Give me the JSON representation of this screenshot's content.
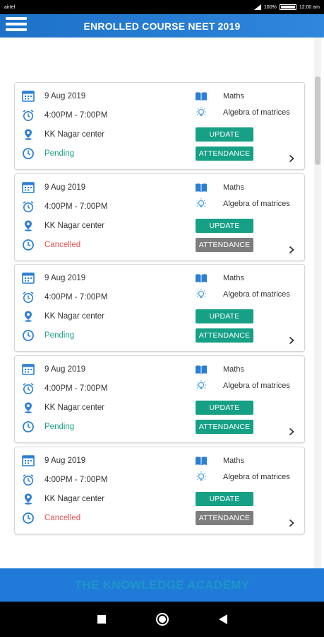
{
  "status_bar": {
    "carrier": "airtel",
    "battery": "100%",
    "time": "12:00 am"
  },
  "app_bar": {
    "title": "ENROLLED COURSE NEET 2019"
  },
  "cards": [
    {
      "date": "9 Aug 2019",
      "time": "4:00PM - 7:00PM",
      "location": "KK Nagar center",
      "status": "Pending",
      "subject": "Maths",
      "topic": "Algebra of matrices",
      "update_label": "UPDATE",
      "attendance_label": "ATTENDANCE"
    },
    {
      "date": "9 Aug 2019",
      "time": "4:00PM - 7:00PM",
      "location": "KK Nagar center",
      "status": "Cancelled",
      "subject": "Maths",
      "topic": "Algebra of matrices",
      "update_label": "UPDATE",
      "attendance_label": "ATTENDANCE"
    },
    {
      "date": "9 Aug 2019",
      "time": "4:00PM - 7:00PM",
      "location": "KK Nagar center",
      "status": "Pending",
      "subject": "Maths",
      "topic": "Algebra of matrices",
      "update_label": "UPDATE",
      "attendance_label": "ATTENDANCE"
    },
    {
      "date": "9 Aug 2019",
      "time": "4:00PM - 7:00PM",
      "location": "KK Nagar center",
      "status": "Pending",
      "subject": "Maths",
      "topic": "Algebra of matrices",
      "update_label": "UPDATE",
      "attendance_label": "ATTENDANCE"
    },
    {
      "date": "9 Aug 2019",
      "time": "4:00PM - 7:00PM",
      "location": "KK Nagar center",
      "status": "Cancelled",
      "subject": "Maths",
      "topic": "Algebra of matrices",
      "update_label": "UPDATE",
      "attendance_label": "ATTENDANCE"
    }
  ],
  "footer": {
    "text": "THE KNOWLEDGE ACADEMY"
  },
  "colors": {
    "primary": "#1f7ad8",
    "accent_green": "#16a086",
    "pending": "#1ea28a",
    "cancelled": "#e45353",
    "disabled": "#7d7d7d"
  },
  "icons": {
    "date": "calendar-icon",
    "time": "alarm-clock-icon",
    "location": "map-pin-icon",
    "status": "clock-icon",
    "subject": "book-icon",
    "topic": "bulb-icon",
    "more": "chevron-right-icon"
  }
}
